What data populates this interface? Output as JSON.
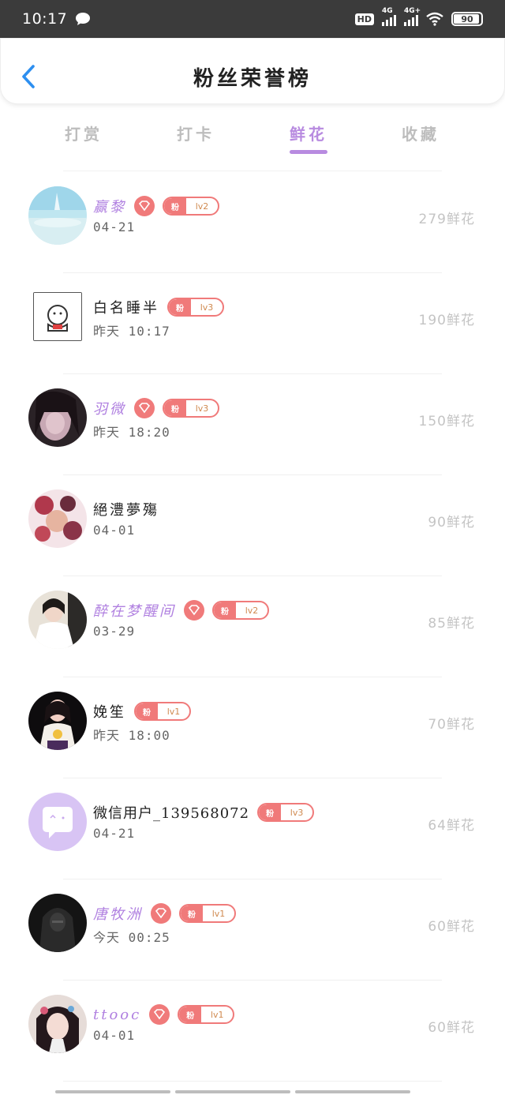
{
  "status_bar": {
    "time": "10:17",
    "hd_label": "HD",
    "signal1_label": "4G",
    "signal2_label": "4G+",
    "battery": "90"
  },
  "header": {
    "title": "粉丝荣誉榜",
    "back_icon": "chevron-left-icon"
  },
  "tabs": [
    {
      "label": "打赏",
      "active": false
    },
    {
      "label": "打卡",
      "active": false
    },
    {
      "label": "鲜花",
      "active": true
    },
    {
      "label": "收藏",
      "active": false
    }
  ],
  "colors": {
    "accent": "#b88be0",
    "badge": "#f07a7a",
    "count": "#c4c4c4"
  },
  "fans": [
    {
      "name": "赢黎",
      "time": "04-21",
      "count": "279鲜花",
      "level": "lv2",
      "fan_char": "粉",
      "purple": true,
      "diamond": true
    },
    {
      "name": "白名睡半",
      "time": "昨天 10:17",
      "count": "190鲜花",
      "level": "lv3",
      "fan_char": "粉",
      "purple": false,
      "diamond": false
    },
    {
      "name": "羽微",
      "time": "昨天 18:20",
      "count": "150鲜花",
      "level": "lv3",
      "fan_char": "粉",
      "purple": true,
      "diamond": true
    },
    {
      "name": "絕澧夢殤",
      "time": "04-01",
      "count": "90鲜花",
      "level": "",
      "fan_char": "",
      "purple": false,
      "diamond": false
    },
    {
      "name": "醉在梦醒间",
      "time": "03-29",
      "count": "85鲜花",
      "level": "lv2",
      "fan_char": "粉",
      "purple": true,
      "diamond": true
    },
    {
      "name": "娩笙",
      "time": "昨天 18:00",
      "count": "70鲜花",
      "level": "lv1",
      "fan_char": "粉",
      "purple": false,
      "diamond": false
    },
    {
      "name": "微信用户_139568072",
      "time": "04-21",
      "count": "64鲜花",
      "level": "lv3",
      "fan_char": "粉",
      "purple": false,
      "diamond": false
    },
    {
      "name": "唐牧洲",
      "time": "今天 00:25",
      "count": "60鲜花",
      "level": "lv1",
      "fan_char": "粉",
      "purple": true,
      "diamond": true
    },
    {
      "name": "ttooc",
      "time": "04-01",
      "count": "60鲜花",
      "level": "lv1",
      "fan_char": "粉",
      "purple": true,
      "diamond": true
    }
  ]
}
